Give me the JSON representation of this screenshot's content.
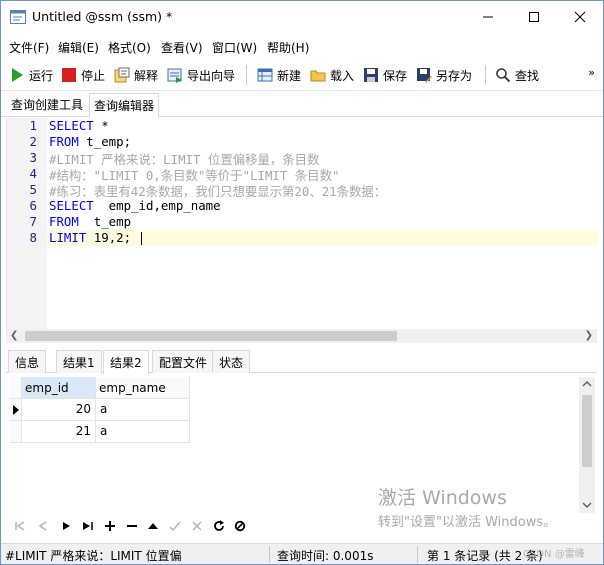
{
  "window": {
    "title": "Untitled @ssm (ssm) *"
  },
  "menu": [
    "文件(F)",
    "编辑(E)",
    "格式(O)",
    "查看(V)",
    "窗口(W)",
    "帮助(H)"
  ],
  "toolbar": {
    "run": "运行",
    "stop": "停止",
    "explain": "解释",
    "export_wizard": "导出向导",
    "new": "新建",
    "load": "载入",
    "save": "保存",
    "save_as": "另存为",
    "find": "查找",
    "more": "»"
  },
  "editor_tabs": [
    "查询创建工具",
    "查询编辑器"
  ],
  "editor": {
    "lines": [
      {
        "n": "1",
        "segments": [
          {
            "cls": "kw",
            "text": "SELECT"
          },
          {
            "cls": "tx",
            "text": " *"
          }
        ]
      },
      {
        "n": "2",
        "segments": [
          {
            "cls": "kw",
            "text": "FROM"
          },
          {
            "cls": "tx",
            "text": " t_emp;"
          }
        ]
      },
      {
        "n": "3",
        "segments": [
          {
            "cls": "cm",
            "text": "#LIMIT 严格来说：LIMIT 位置偏移量，条目数"
          }
        ]
      },
      {
        "n": "4",
        "segments": [
          {
            "cls": "cm",
            "text": "#结构：\"LIMIT 0,条目数\"等价于\"LIMIT 条目数\""
          }
        ]
      },
      {
        "n": "5",
        "segments": [
          {
            "cls": "cm",
            "text": "#练习：表里有42条数据，我们只想要显示第20、21条数据："
          }
        ]
      },
      {
        "n": "6",
        "segments": [
          {
            "cls": "kw",
            "text": "SELECT"
          },
          {
            "cls": "tx",
            "text": "  emp_id,emp_name"
          }
        ]
      },
      {
        "n": "7",
        "segments": [
          {
            "cls": "kw",
            "text": "FROM"
          },
          {
            "cls": "tx",
            "text": "  t_emp"
          }
        ]
      },
      {
        "n": "8",
        "segments": [
          {
            "cls": "kw",
            "text": "LIMIT"
          },
          {
            "cls": "tx",
            "text": " 19,2;"
          }
        ]
      }
    ]
  },
  "result_tabs": [
    "信息",
    "结果1",
    "结果2",
    "配置文件",
    "状态"
  ],
  "result_grid": {
    "columns": [
      "emp_id",
      "emp_name"
    ],
    "rows": [
      [
        "20",
        "a"
      ],
      [
        "21",
        "a"
      ]
    ]
  },
  "watermark": {
    "line1": "激活 Windows",
    "line2": "转到\"设置\"以激活 Windows。"
  },
  "status": {
    "sql_preview": "#LIMIT 严格来说：LIMIT 位置偏",
    "query_time": "查询时间: 0.001s",
    "record": "第 1 条记录 (共 2 条)",
    "credit": "CSDN @雷峰"
  },
  "colors": {
    "keyword": "#0000ff",
    "comment": "#a8a8a8",
    "line_number": "#1f1f8f",
    "selected_header": "#d9e9f7"
  }
}
